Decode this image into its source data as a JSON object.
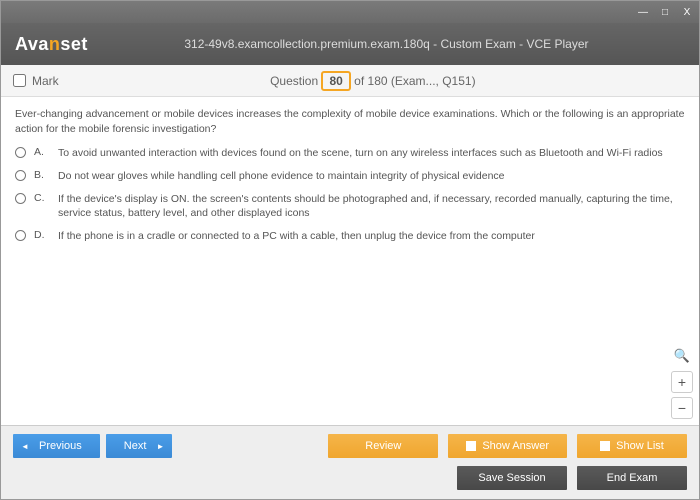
{
  "titlebar": {
    "min": "—",
    "max": "□",
    "close": "X"
  },
  "logo": {
    "pre": "Ava",
    "mid": "n",
    "post": "set"
  },
  "header": {
    "title": "312-49v8.examcollection.premium.exam.180q - Custom Exam - VCE Player"
  },
  "qbar": {
    "mark": "Mark",
    "question_label": "Question",
    "current": "80",
    "total_suffix": "  of 180 (Exam..., Q151)"
  },
  "question": {
    "text": "Ever-changing advancement or mobile devices increases the complexity of mobile device examinations. Which or the following is an appropriate action for the mobile forensic investigation?"
  },
  "options": [
    {
      "letter": "A.",
      "text": "To avoid unwanted interaction with devices found on the scene, turn on any wireless interfaces such as Bluetooth and Wi-Fi radios"
    },
    {
      "letter": "B.",
      "text": "Do not wear gloves while handling cell phone evidence to maintain integrity of physical evidence"
    },
    {
      "letter": "C.",
      "text": "If the device's display is ON. the screen's contents should be photographed and, if necessary, recorded manually, capturing the time, service status, battery level, and other displayed icons"
    },
    {
      "letter": "D.",
      "text": "If the phone is in a cradle or connected to a PC with a cable, then unplug the device from the computer"
    }
  ],
  "footer": {
    "previous": "Previous",
    "next": "Next",
    "review": "Review",
    "show_answer": "Show Answer",
    "show_list": "Show List",
    "save_session": "Save Session",
    "end_exam": "End Exam"
  },
  "zoom": {
    "plus": "+",
    "minus": "−",
    "search": "🔍"
  }
}
